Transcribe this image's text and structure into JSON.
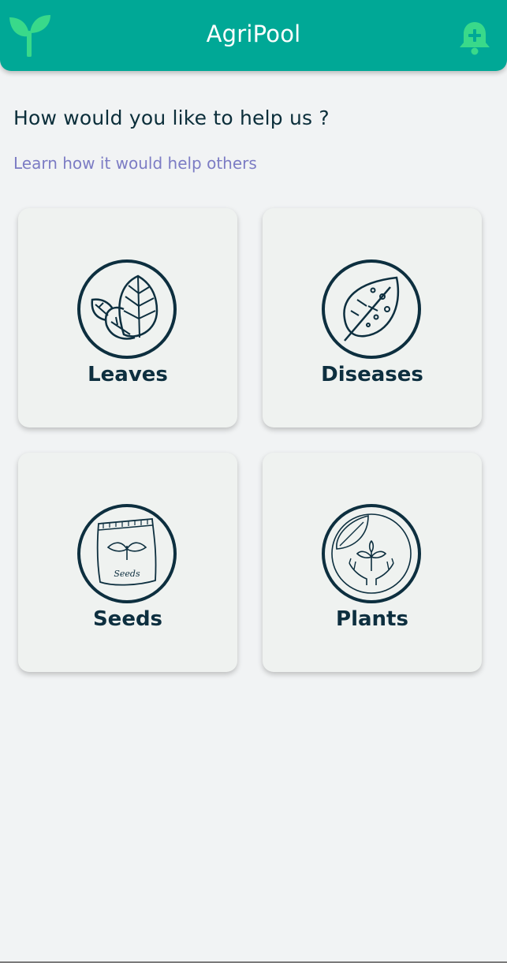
{
  "app": {
    "title": "AgriPool",
    "accent_color": "#00a896"
  },
  "header": {
    "logo_icon": "sprout-icon",
    "notification_icon": "bell-plus-icon"
  },
  "main": {
    "headline": "How would you like to help us ?",
    "learn_link": "Learn how it would help others",
    "categories": [
      {
        "label": "Leaves",
        "icon": "leaves-icon"
      },
      {
        "label": "Diseases",
        "icon": "diseased-leaf-icon"
      },
      {
        "label": "Seeds",
        "icon": "seed-bag-icon",
        "icon_text": "Seeds"
      },
      {
        "label": "Plants",
        "icon": "plant-in-hands-icon"
      }
    ]
  }
}
